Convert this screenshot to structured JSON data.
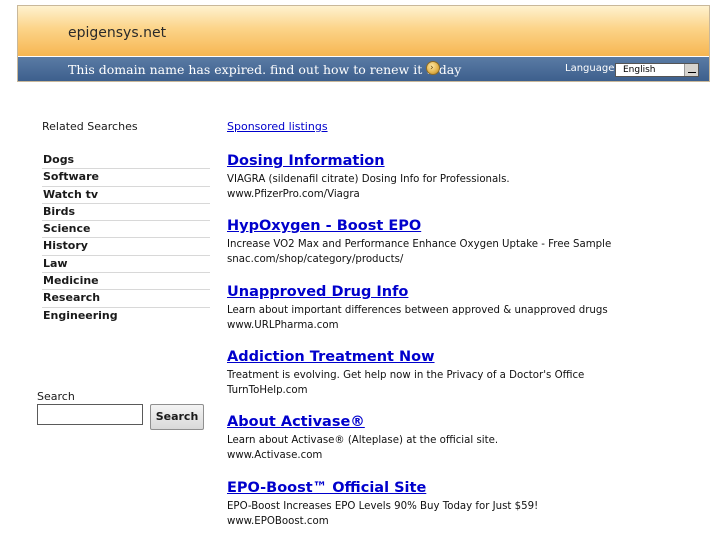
{
  "header": {
    "site_title": "epigensys.net",
    "expired_message": "This domain name has expired. find out how to renew it today",
    "language_label": "Language:",
    "language_selected": "English"
  },
  "sidebar": {
    "related_title": "Related Searches",
    "items": [
      {
        "label": "Dogs"
      },
      {
        "label": "Software"
      },
      {
        "label": "Watch tv"
      },
      {
        "label": "Birds"
      },
      {
        "label": "Science"
      },
      {
        "label": "History"
      },
      {
        "label": "Law"
      },
      {
        "label": "Medicine"
      },
      {
        "label": "Research"
      },
      {
        "label": "Engineering"
      }
    ],
    "search_label": "Search",
    "search_value": "",
    "search_button": "Search"
  },
  "main": {
    "sponsored_label": "Sponsored listings",
    "listings": [
      {
        "title": "Dosing Information",
        "desc": "VIAGRA (sildenafil citrate) Dosing Info for Professionals.",
        "url": "www.PfizerPro.com/Viagra"
      },
      {
        "title": "HypOxygen - Boost EPO",
        "desc": "Increase VO2 Max and Performance Enhance Oxygen Uptake - Free Sample",
        "url": "snac.com/shop/category/products/"
      },
      {
        "title": "Unapproved Drug Info",
        "desc": "Learn about important differences between approved & unapproved drugs",
        "url": "www.URLPharma.com"
      },
      {
        "title": "Addiction Treatment Now",
        "desc": "Treatment is evolving. Get help now in the Privacy of a Doctor's Office",
        "url": "TurnToHelp.com"
      },
      {
        "title": "About Activase®",
        "desc": "Learn about Activase® (Alteplase) at the official site.",
        "url": "www.Activase.com"
      },
      {
        "title": "EPO-Boost™ Official Site",
        "desc": "EPO-Boost Increases EPO Levels 90% Buy Today for Just $59!",
        "url": "www.EPOBoost.com"
      }
    ]
  },
  "colors": {
    "link": "#0000cc",
    "header_orange": "#f6b652",
    "header_blue": "#3d5f8d"
  }
}
